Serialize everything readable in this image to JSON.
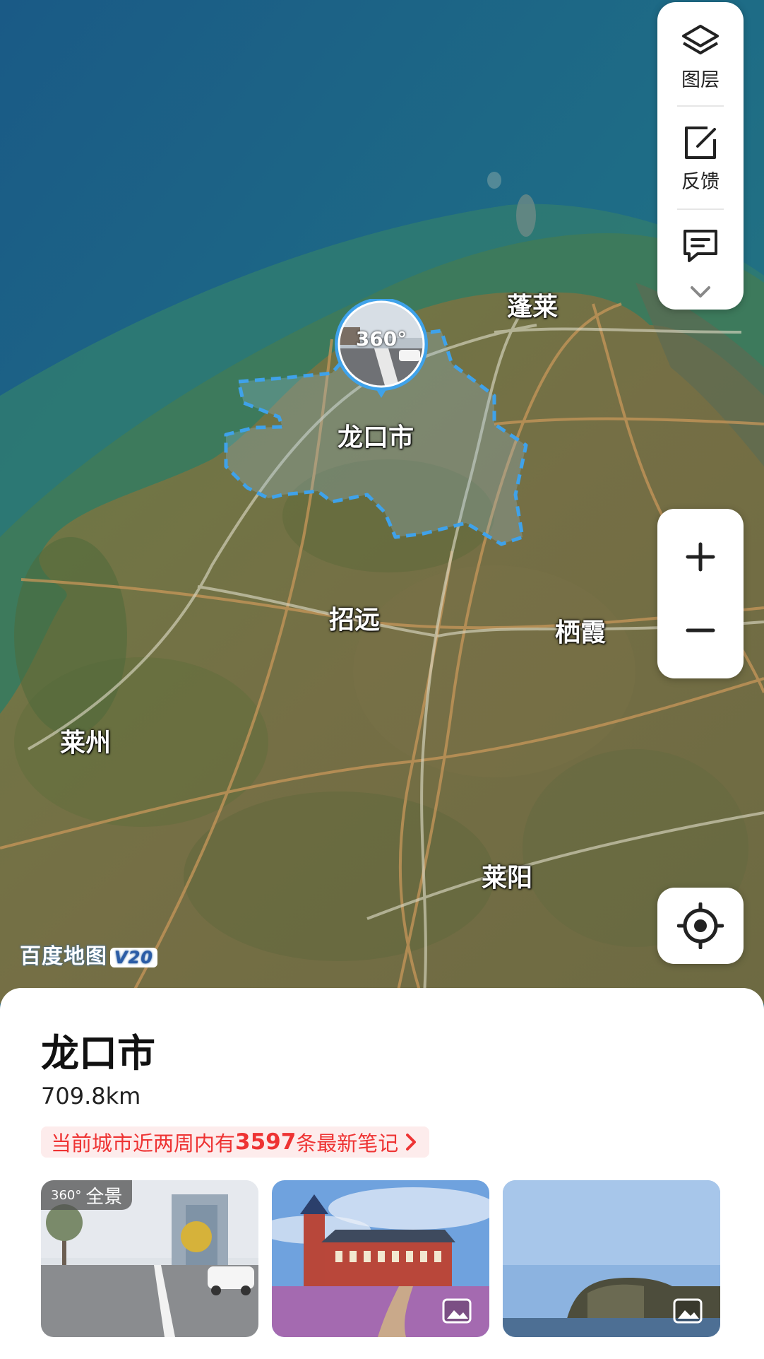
{
  "map": {
    "places": [
      {
        "id": "penglai",
        "name": "蓬莱"
      },
      {
        "id": "longkou",
        "name": "龙口市"
      },
      {
        "id": "zhaoyuan",
        "name": "招远"
      },
      {
        "id": "qixia",
        "name": "栖霞"
      },
      {
        "id": "laizhou",
        "name": "莱州"
      },
      {
        "id": "laiyang",
        "name": "莱阳"
      }
    ],
    "pin_label": "360°",
    "watermark": "百度地图",
    "watermark_version": "V20"
  },
  "toolbar": {
    "layers_label": "图层",
    "feedback_label": "反馈",
    "more_icon": "chevron-down-icon"
  },
  "zoom": {
    "in_symbol": "+",
    "out_symbol": "−"
  },
  "sheet": {
    "title": "龙口市",
    "distance": "709.8km",
    "notes": {
      "prefix": "当前城市近两周内有",
      "count": "3597",
      "suffix": "条最新笔记"
    },
    "thumbnails": [
      {
        "tag_icon": "360°",
        "tag_text": "全景",
        "kind": "panorama"
      },
      {
        "kind": "photo",
        "icon": "image-icon"
      },
      {
        "kind": "photo",
        "icon": "image-icon"
      }
    ]
  },
  "colors": {
    "accent_red": "#e33333",
    "boundary_blue": "#3fa2ea",
    "sea": "#1d5f7a"
  }
}
